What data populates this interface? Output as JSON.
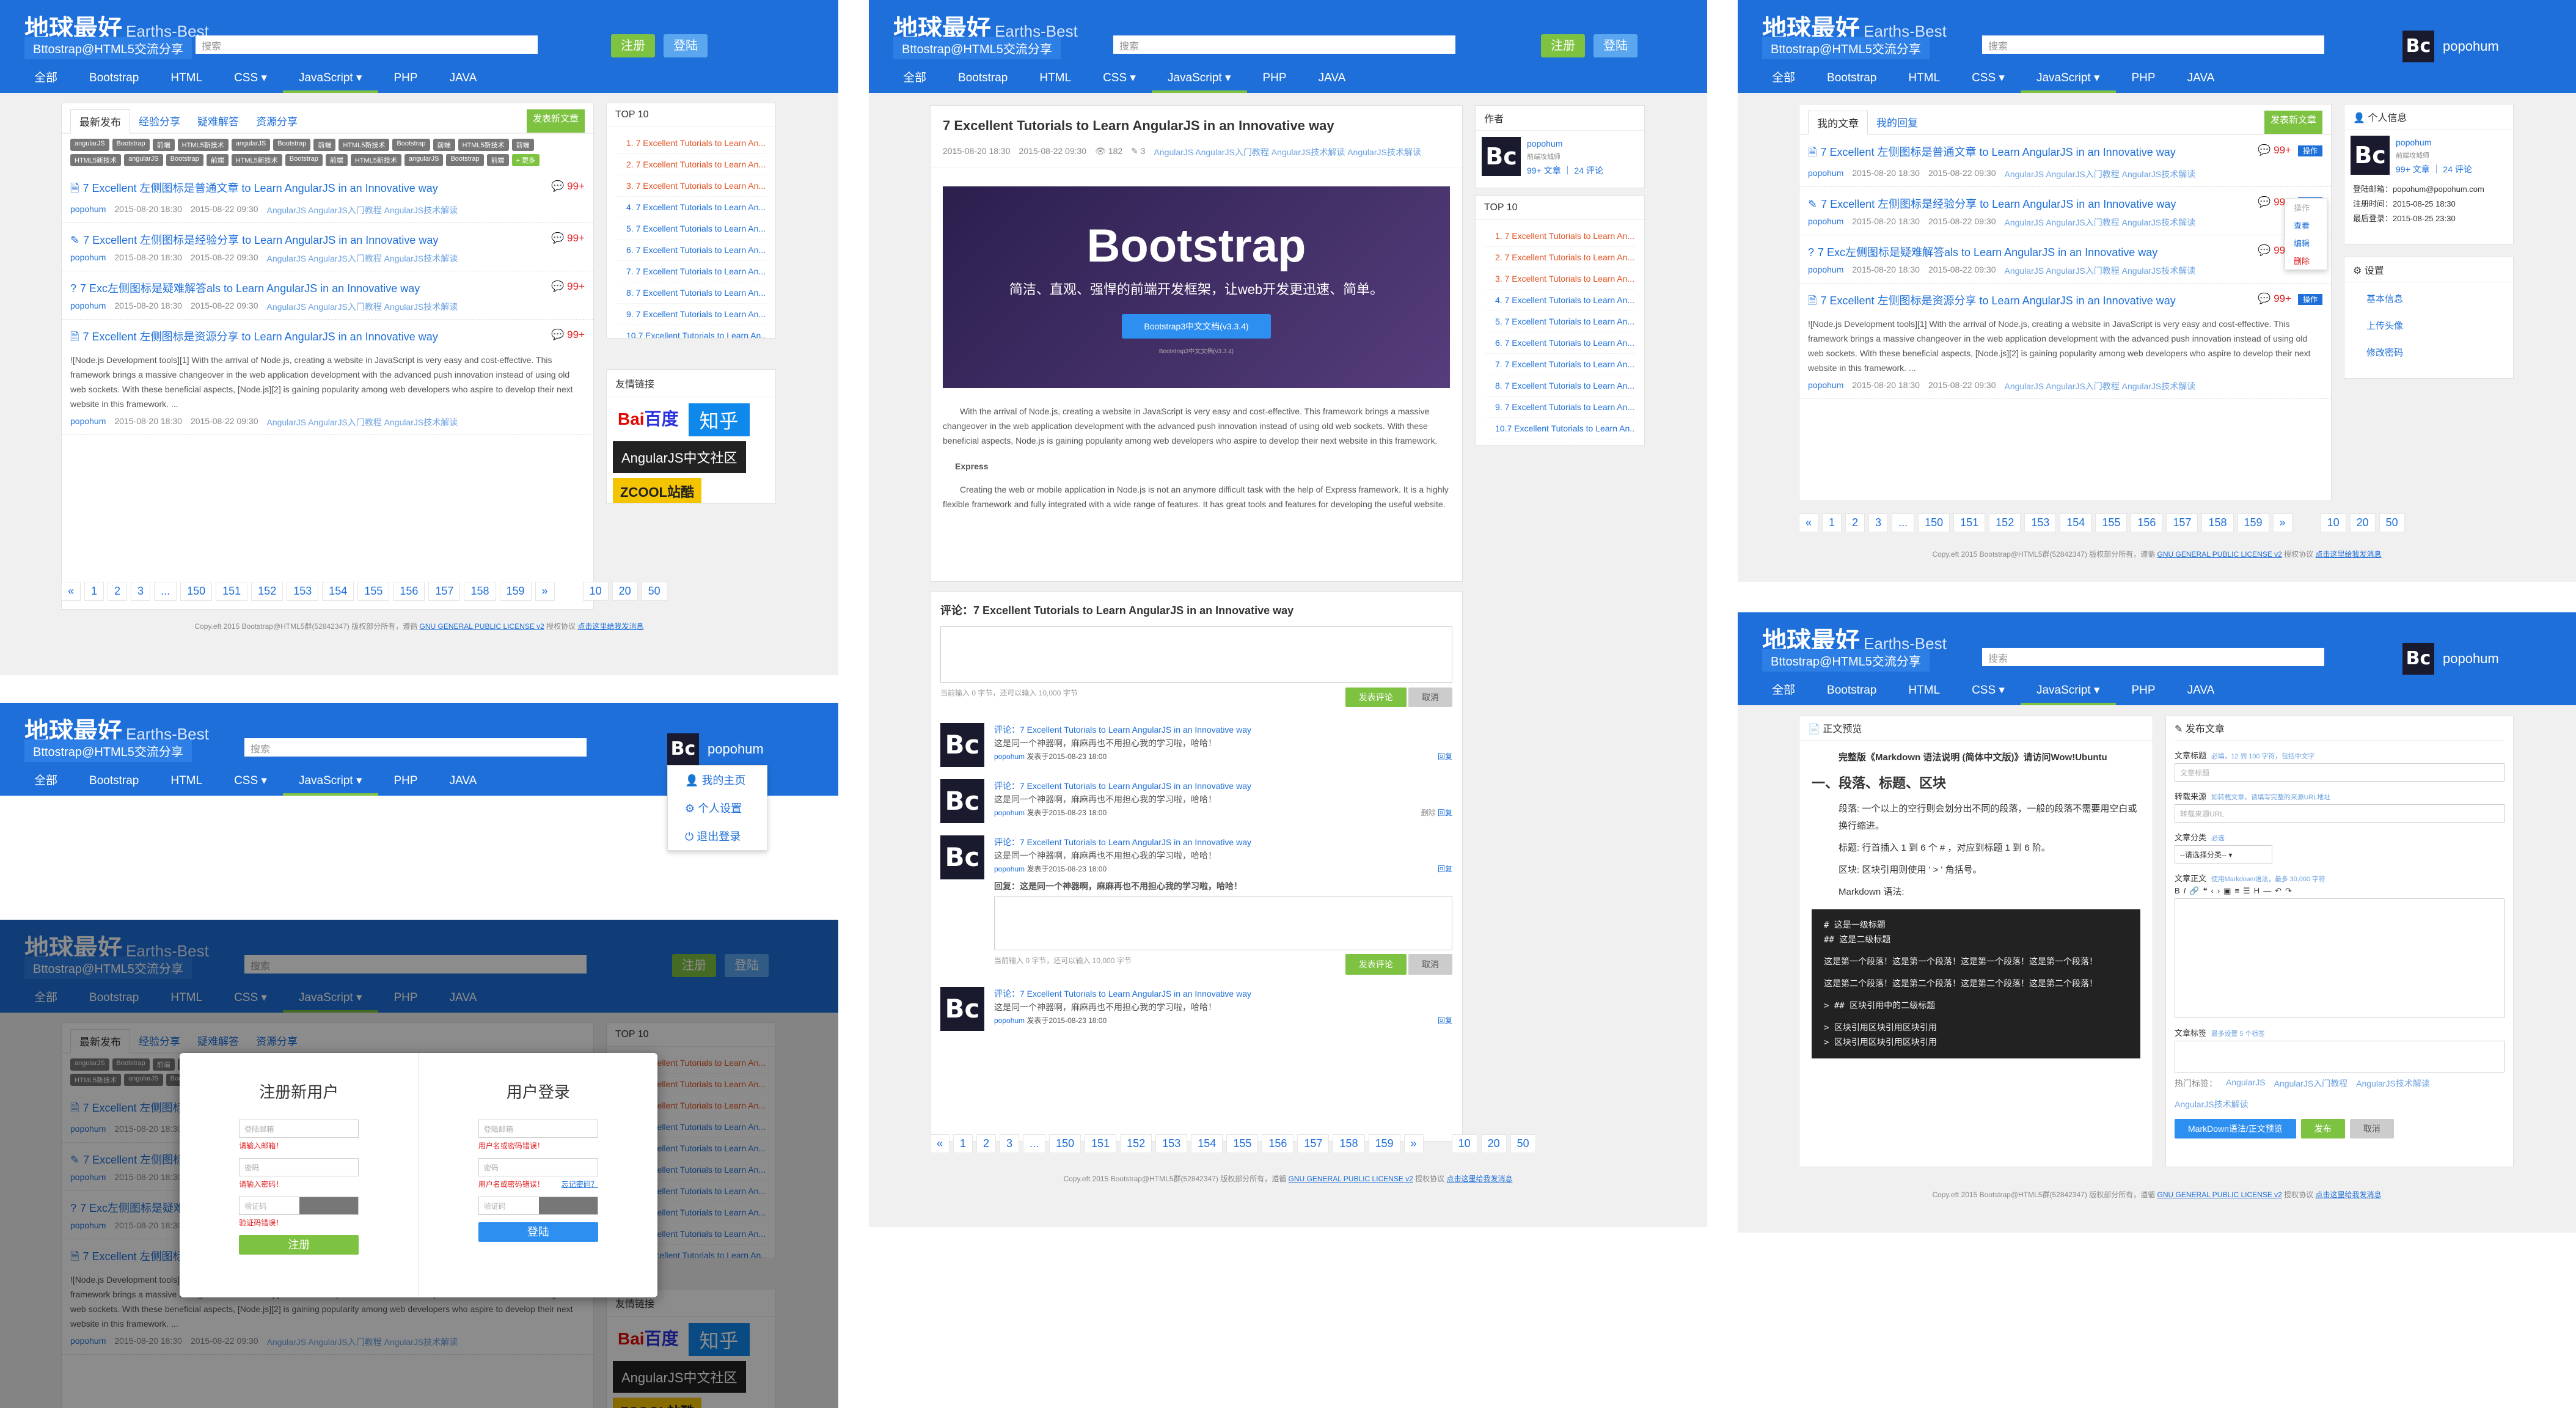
{
  "site": {
    "brand": "地球最好",
    "brand_sub": "Earths-Best",
    "slogan": "Bttostrap@HTML5交流分享",
    "search_placeholder": "搜索",
    "register": "注册",
    "login": "登陆",
    "username": "popohum",
    "avatar_text": "Bc"
  },
  "nav": [
    "全部",
    "Bootstrap",
    "HTML",
    "CSS ▾",
    "JavaScript ▾",
    "PHP",
    "JAVA"
  ],
  "home": {
    "tabs": [
      "最新发布",
      "经验分享",
      "疑难解答",
      "资源分享"
    ],
    "new_post_btn": "发表新文章",
    "tags": [
      "angularJS",
      "Bootstrap",
      "前端",
      "HTML5新技术",
      "angularJS",
      "Bootstrap",
      "前端",
      "HTML5新技术",
      "Bootstrap",
      "前端",
      "HTML5新技术",
      "前端",
      "HTML5新技术",
      "angularJS",
      "Bootstrap",
      "前端",
      "HTML5新技术",
      "Bootstrap",
      "前端",
      "HTML5新技术",
      "angularJS",
      "Bootstrap",
      "前端",
      "+ 更多"
    ],
    "posts": [
      {
        "title": "7 Excellent 左侧图标是普通文章 to Learn AngularJS in an Innovative way",
        "count": "99+",
        "user": "popohum",
        "date1": "2015-08-20 18:30",
        "date2": "2015-08-22 09:30",
        "kw": "AngularJS  AngularJS入门教程  AngularJS技术解读",
        "icon": "doc-icon"
      },
      {
        "title": "7 Excellent 左侧图标是经验分享 to Learn AngularJS in an Innovative way",
        "count": "99+",
        "user": "popohum",
        "date1": "2015-08-20 18:30",
        "date2": "2015-08-22 09:30",
        "kw": "AngularJS  AngularJS入门教程  AngularJS技术解读",
        "icon": "pencil-icon"
      },
      {
        "title": "7 Exc左侧图标是疑难解答als to Learn AngularJS in an Innovative way",
        "count": "99+",
        "user": "popohum",
        "date1": "2015-08-20 18:30",
        "date2": "2015-08-22 09:30",
        "kw": "AngularJS  AngularJS入门教程  AngularJS技术解读",
        "icon": "question-icon"
      },
      {
        "title": "7 Excellent 左侧图标是资源分享 to Learn AngularJS in an Innovative way",
        "count": "99+",
        "user": "popohum",
        "date1": "2015-08-20 18:30",
        "date2": "2015-08-22 09:30",
        "kw": "AngularJS  AngularJS入门教程  AngularJS技术解读",
        "icon": "doc-icon"
      }
    ],
    "excerpt": "![Node.js Development tools][1] With the arrival of Node.js, creating a website in JavaScript is very easy and cost-effective. This framework brings a massive changeover in the web application development with the advanced push innovation instead of using old web sockets. With these beneficial aspects, [Node.js][2] is gaining popularity among web developers who aspire to develop their next website in this framework. ...",
    "pager": [
      "«",
      "1",
      "2",
      "3",
      "...",
      "150",
      "151",
      "152",
      "153",
      "154",
      "155",
      "156",
      "157",
      "158",
      "159",
      "»"
    ],
    "per_page": [
      "10",
      "20",
      "50"
    ]
  },
  "top10": {
    "title": "TOP 10",
    "items": [
      "1. 7 Excellent Tutorials to Learn An...",
      "2. 7 Excellent Tutorials to Learn An...",
      "3. 7 Excellent Tutorials to Learn An...",
      "4. 7 Excellent Tutorials to Learn An...",
      "5. 7 Excellent Tutorials to Learn An...",
      "6. 7 Excellent Tutorials to Learn An...",
      "7. 7 Excellent Tutorials to Learn An...",
      "8. 7 Excellent Tutorials to Learn An...",
      "9. 7 Excellent Tutorials to Learn An...",
      "10.7 Excellent Tutorials to Learn An..."
    ]
  },
  "links": {
    "title": "友情链接",
    "baidu": "Bai百度",
    "zhihu": "知乎",
    "angular": "AngularJS中文社区",
    "zcool": "ZCOOL站酷"
  },
  "footer": {
    "text": "Copy.eft 2015 Bootstrap@HTML5群(52842347) 版权部分所有，遵循",
    "license": "GNU GENERAL PUBLIC LICENSE v2",
    "tail": "授权协议",
    "contact": "点击这里给我发消息"
  },
  "dropdown": [
    "我的主页",
    "个人设置",
    "退出登录"
  ],
  "modal": {
    "reg_title": "注册新用户",
    "login_title": "用户登录",
    "email_ph": "登陆邮箱",
    "email_err": "请输入邮箱！",
    "pwd_ph": "密码",
    "pwd_err": "请输入密码！",
    "code_ph": "验证码",
    "code_err": "验证码错误！",
    "reg_btn": "注册",
    "login_email_err": "用户名或密码错误！",
    "login_pwd_err": "用户名或密码错误！",
    "forgot": "忘记密码？",
    "login_btn": "登陆"
  },
  "article": {
    "title": "7 Excellent Tutorials to Learn AngularJS in an Innovative way",
    "date1": "2015-08-20 18:30",
    "date2": "2015-08-22 09:30",
    "views": "182",
    "comments": "3",
    "kw": "AngularJS  AngularJS入门教程  AngularJS技术解读  AngularJS技术解读",
    "banner_title": "Bootstrap",
    "banner_sub": "简洁、直观、强悍的前端开发框架，让web开发更迅速、简单。",
    "banner_btn": "Bootstrap3中文文档(v3.3.4)",
    "banner_small": "Bootstrap3中文文档(v3.3.4)",
    "body1": "With the arrival of Node.js, creating a website in JavaScript is very easy and cost-effective. This framework brings a massive changeover in the web application development with the advanced push innovation instead of using old web sockets. With these beneficial aspects, Node.js is gaining popularity among web developers who aspire to develop their next website in this framework.",
    "h_express": "Express",
    "body2": "Creating the web or mobile application in Node.js is not an anymore difficult task with the help of Express framework. It is a highly flexible framework and fully integrated with a wide range of features. It has great tools and features for developing the useful website.",
    "cmt_title": "评论：7 Excellent Tutorials to Learn AngularJS in an Innovative way",
    "cmt_hint": "当前输入 0 字节，还可以输入 10,000 字节",
    "publish": "发表评论",
    "cancel": "取消",
    "reply_prefix": "评论：7 Excellent Tutorials to Learn AngularJS in an Innovative way",
    "reply_text": "这是同一个神器啊，麻麻再也不用担心我的学习啦，哈哈！",
    "reply_meta": "发表于2015-08-23 18:00",
    "reply_link": "回复",
    "delete": "删除",
    "sub_reply": "回复：这是同一个神器啊，麻麻再也不用担心我的学习啦，哈哈！"
  },
  "author": {
    "title": "作者",
    "name": "popohum",
    "sub": "前端攻城师",
    "stats": "99+ 文章 ｜ 24 评论"
  },
  "my": {
    "tabs": [
      "我的文章",
      "我的回复"
    ],
    "op": "操作",
    "menu": [
      "操作",
      "查看",
      "编辑",
      "删除"
    ],
    "profile_title": "个人信息",
    "email_label": "登陆邮箱",
    "email": "popohum@popohum.com",
    "reg_label": "注册时间",
    "reg_time": "2015-08-25 18:30",
    "last_label": "最后登录",
    "last_time": "2015-08-25 23:30",
    "settings_title": "设置",
    "settings": [
      "基本信息",
      "上传头像",
      "修改密码"
    ]
  },
  "editor": {
    "preview_title": "正文预览",
    "md_title": "完整版《Markdown 语法说明 (简体中文版)》请访问Wow!Ubuntu",
    "h1": "一、段落、标题、区块",
    "p1": "段落: 一个以上的空行则会划分出不同的段落，一般的段落不需要用空白或换行缩进。",
    "p2": "标题: 行首插入 1 到 6 个 # ，对应到标题 1 到 6 阶。",
    "p3": "区块: 区块引用则使用 ' > ' 角括号。",
    "p4": "Markdown 语法:",
    "code": [
      "# 这是一级标题",
      "## 这是二级标题",
      "",
      "这是第一个段落！这是第一个段落！这是第一个段落！这是第一个段落！",
      "",
      "这是第二个段落！这是第二个段落！这是第二个段落！这是第二个段落！",
      "",
      "> ## 区块引用中的二级标题",
      "",
      "> 区块引用区块引用区块引用",
      "> 区块引用区块引用区块引用"
    ],
    "form_title": "发布文章",
    "f_title": "文章标题",
    "f_title_hint": "必填，12 到 100 字符，包括中文字",
    "f_title_ph": "文章标题",
    "f_src": "转载来源",
    "f_src_hint": "如转载文章，请填写完整的来源URL地址",
    "f_src_ph": "转载来源URL",
    "f_cat": "文章分类",
    "f_cat_hint": "必选",
    "f_cat_sel": "--请选择分类--",
    "f_body": "文章正文",
    "f_body_hint": "使用Markdown语法，最多 30,000 字符",
    "f_kw": "文章标签",
    "f_kw_hint": "最多设置 5 个标签",
    "hot": "热门标签：",
    "md_btn": "MarkDown语法/正文预览",
    "publish": "发布",
    "cancel": "取消"
  }
}
